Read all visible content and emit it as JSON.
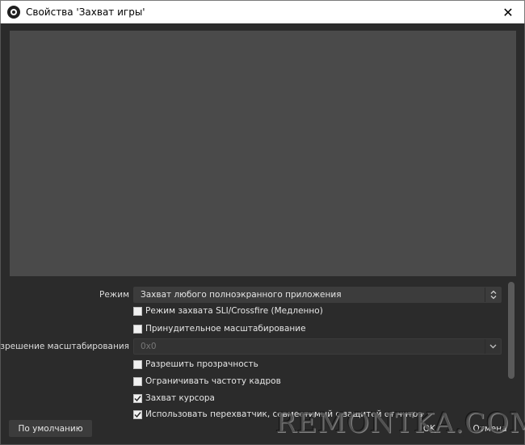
{
  "window": {
    "title": "Свойства 'Захват игры'",
    "close_symbol": "✕"
  },
  "settings": {
    "mode_label": "Режим",
    "mode_value": "Захват любого полноэкранного приложения",
    "sli_crossfire_label": "Режим захвата SLI/Crossfire (Медленно)",
    "sli_crossfire_checked": false,
    "force_scaling_label": "Принудительное масштабирование",
    "force_scaling_checked": false,
    "scale_resolution_label": "Разрешение масштабирования",
    "scale_resolution_value": "0x0",
    "allow_transparency_label": "Разрешить прозрачность",
    "allow_transparency_checked": false,
    "limit_framerate_label": "Ограничивать частоту кадров",
    "limit_framerate_checked": false,
    "capture_cursor_label": "Захват курсора",
    "capture_cursor_checked": true,
    "anticheat_hook_label": "Использовать перехватчик, совместимый с защитой от читов",
    "anticheat_hook_checked": true
  },
  "footer": {
    "defaults_label": "По умолчанию",
    "ok_label": "OK",
    "cancel_label": "Отмена"
  },
  "watermark": "REMONTKA.COM",
  "icons": {
    "app": "obs-logo-icon",
    "close": "close-icon",
    "dropdown": "chevron-updown-icon",
    "check": "checkmark-icon"
  }
}
